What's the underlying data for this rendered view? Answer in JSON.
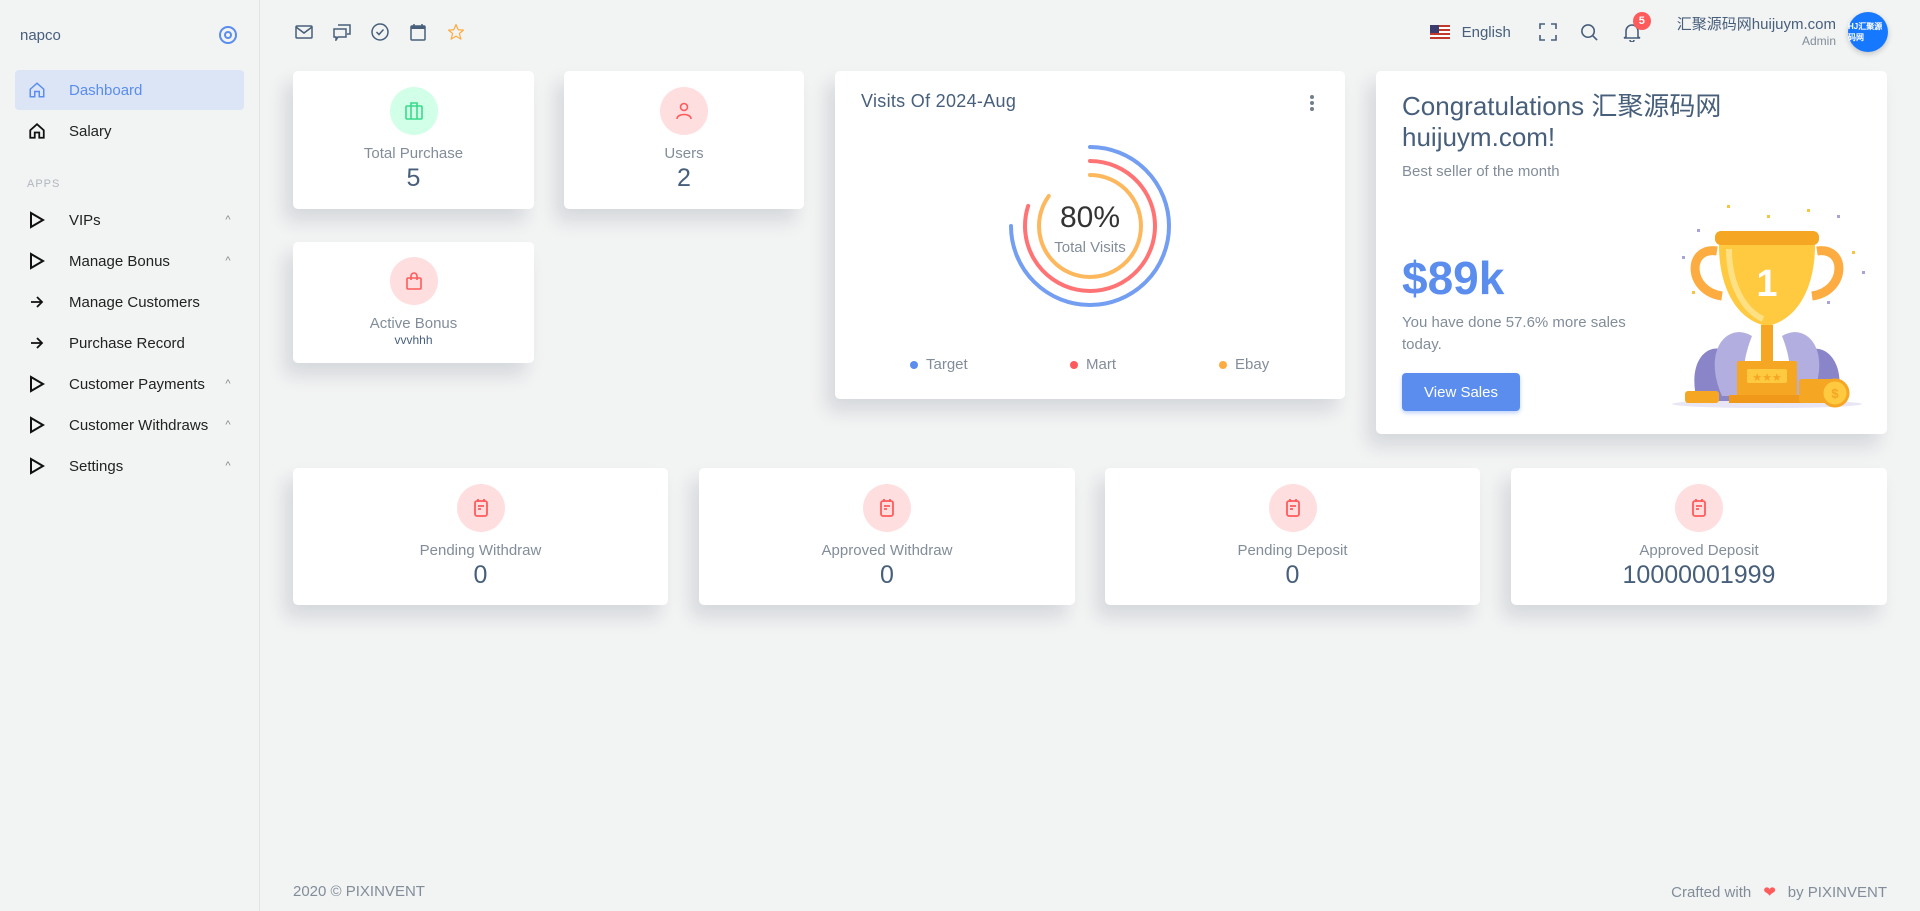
{
  "brand": {
    "name": "napco",
    "toggle_icon": "disc-icon"
  },
  "sidebar": {
    "top_items": [
      {
        "label": "Dashboard",
        "icon": "home-icon",
        "active": true
      },
      {
        "label": "Salary",
        "icon": "home-icon",
        "active": false
      }
    ],
    "section_label": "APPS",
    "app_items": [
      {
        "label": "VIPs",
        "icon": "triangle-right-icon",
        "chevron": "^"
      },
      {
        "label": "Manage Bonus",
        "icon": "triangle-right-icon",
        "chevron": "^"
      },
      {
        "label": "Manage Customers",
        "icon": "arrow-right-icon",
        "chevron": ""
      },
      {
        "label": "Purchase Record",
        "icon": "arrow-right-icon",
        "chevron": ""
      },
      {
        "label": "Customer Payments",
        "icon": "triangle-right-icon",
        "chevron": "^"
      },
      {
        "label": "Customer Withdraws",
        "icon": "triangle-right-icon",
        "chevron": "^"
      },
      {
        "label": "Settings",
        "icon": "triangle-right-icon",
        "chevron": "^"
      }
    ]
  },
  "header": {
    "quick_icons": [
      "mail-icon",
      "chat-icon",
      "check-circle-icon",
      "calendar-icon",
      "star-icon"
    ],
    "language": "English",
    "notification_count": "5",
    "user_name": "汇聚源码网huijuym.com",
    "user_role": "Admin",
    "avatar_text": "HJ汇聚源码网"
  },
  "stats_top": {
    "total_purchase": {
      "label": "Total Purchase",
      "value": "5"
    },
    "users": {
      "label": "Users",
      "value": "2"
    },
    "active_bonus": {
      "label": "Active Bonus",
      "value": "vvvhhh"
    }
  },
  "visits": {
    "title": "Visits Of 2024-Aug",
    "center_value": "80%",
    "center_label": "Total Visits"
  },
  "chart_data": {
    "type": "radialBar",
    "title": "Visits Of 2024-Aug",
    "center_value": "80%",
    "center_label": "Total Visits",
    "series": [
      {
        "name": "Target",
        "value": 75,
        "color": "#5A8DEE"
      },
      {
        "name": "Mart",
        "value": 80,
        "color": "#FF5B5C"
      },
      {
        "name": "Ebay",
        "value": 85,
        "color": "#FDAC41"
      }
    ],
    "legend": "bottom"
  },
  "congrats": {
    "title": "Congratulations 汇聚源码网 huijuym.com!",
    "subtitle": "Best seller of the month",
    "amount": "$89k",
    "description": "You have done 57.6% more sales today.",
    "button": "View Sales"
  },
  "stats_bottom": [
    {
      "label": "Pending Withdraw",
      "value": "0"
    },
    {
      "label": "Approved Withdraw",
      "value": "0"
    },
    {
      "label": "Pending Deposit",
      "value": "0"
    },
    {
      "label": "Approved Deposit",
      "value": "10000001999"
    }
  ],
  "footer": {
    "left": "2020 © PIXINVENT",
    "right_prefix": "Crafted with",
    "right_suffix": "by PIXINVENT"
  },
  "colors": {
    "primary": "#5A8DEE",
    "danger": "#FF5B5C",
    "warning": "#FDAC41",
    "success": "#39DA8A"
  }
}
